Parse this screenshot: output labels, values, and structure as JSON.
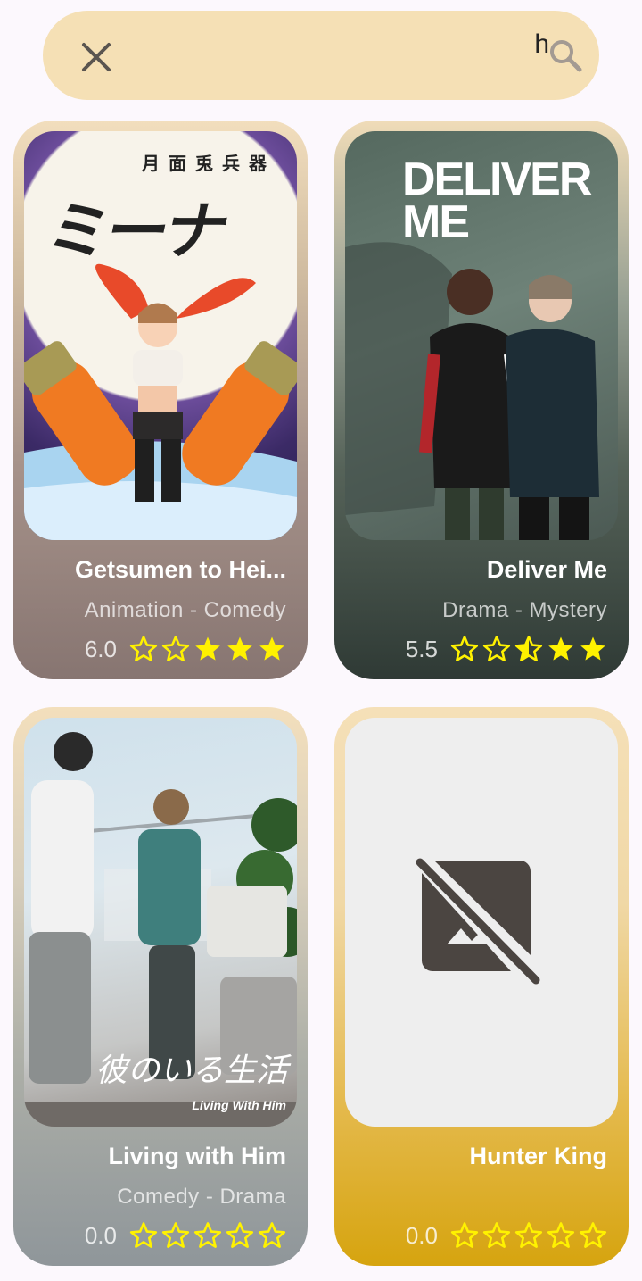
{
  "search": {
    "query": "h"
  },
  "results": [
    {
      "title": "Getsumen to Hei...",
      "genres": "Animation - Comedy",
      "rating": "6.0",
      "stars": [
        "outline",
        "outline",
        "full",
        "full",
        "full"
      ],
      "poster": {
        "title_jp": "ミーナ",
        "subtitle_jp": "月面兎兵器"
      }
    },
    {
      "title": "Deliver Me",
      "genres": "Drama - Mystery",
      "rating": "5.5",
      "stars": [
        "outline",
        "outline",
        "half",
        "full",
        "full"
      ],
      "poster": {
        "title_line1": "DELIVER",
        "title_line2": "ME"
      }
    },
    {
      "title": "Living with Him",
      "genres": "Comedy - Drama",
      "rating": "0.0",
      "stars": [
        "outline",
        "outline",
        "outline",
        "outline",
        "outline"
      ],
      "poster": {
        "title_jp": "彼のいる生活",
        "title_en": "Living With Him"
      }
    },
    {
      "title": "Hunter King",
      "genres": "",
      "rating": "0.0",
      "stars": [
        "outline",
        "outline",
        "outline",
        "outline",
        "outline"
      ],
      "poster": {
        "placeholder_icon": "broken-image-icon"
      }
    }
  ],
  "colors": {
    "search_bg": "#f5e0b5",
    "star": "#fff200",
    "page_bg": "#fcf8fd"
  }
}
